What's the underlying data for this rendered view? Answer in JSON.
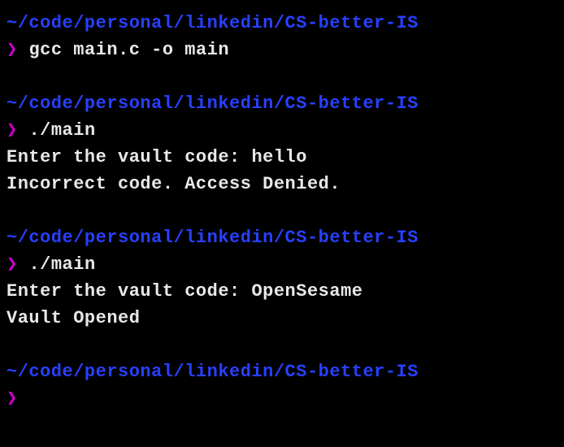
{
  "blocks": [
    {
      "path": "~/code/personal/linkedin/CS-better-IS",
      "prompt": "❯",
      "command": "gcc main.c -o main",
      "output": []
    },
    {
      "path": "~/code/personal/linkedin/CS-better-IS",
      "prompt": "❯",
      "command": "./main",
      "output": [
        "Enter the vault code: hello",
        "Incorrect code. Access Denied."
      ]
    },
    {
      "path": "~/code/personal/linkedin/CS-better-IS",
      "prompt": "❯",
      "command": "./main",
      "output": [
        "Enter the vault code: OpenSesame",
        "Vault Opened"
      ]
    },
    {
      "path": "~/code/personal/linkedin/CS-better-IS",
      "prompt": "❯",
      "command": "",
      "output": []
    }
  ]
}
